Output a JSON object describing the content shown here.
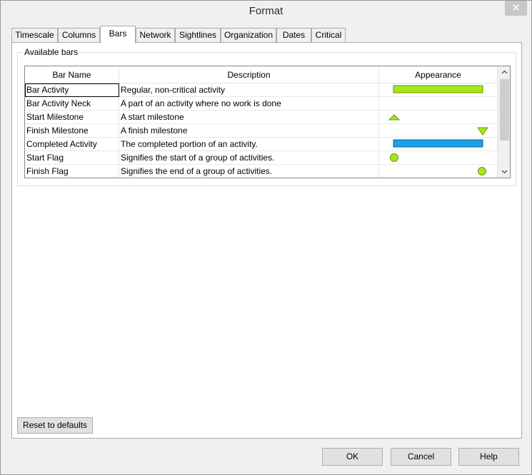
{
  "window": {
    "title": "Format",
    "close_symbol": "✕"
  },
  "tabs": [
    {
      "label": "Timescale",
      "active": false
    },
    {
      "label": "Columns",
      "active": false
    },
    {
      "label": "Bars",
      "active": true
    },
    {
      "label": "Network",
      "active": false
    },
    {
      "label": "Sightlines",
      "active": false
    },
    {
      "label": "Organization",
      "active": false
    },
    {
      "label": "Dates",
      "active": false
    },
    {
      "label": "Critical",
      "active": false
    }
  ],
  "bars_panel": {
    "group_label": "Available bars",
    "columns": [
      "Bar Name",
      "Description",
      "Appearance"
    ],
    "rows": [
      {
        "name": "Bar Activity",
        "description": "Regular, non-critical activity",
        "appearance": "green-bar",
        "selected": true
      },
      {
        "name": "Bar Activity Neck",
        "description": "A part of an activity where no work is done",
        "appearance": "none",
        "selected": false
      },
      {
        "name": "Start Milestone",
        "description": "A start milestone",
        "appearance": "green-up-triangle",
        "selected": false
      },
      {
        "name": "Finish Milestone",
        "description": "A finish milestone",
        "appearance": "green-down-triangle",
        "selected": false
      },
      {
        "name": "Completed Activity",
        "description": "The completed portion of an activity.",
        "appearance": "blue-bar",
        "selected": false
      },
      {
        "name": "Start Flag",
        "description": "Signifies the start of a group of activities.",
        "appearance": "green-circle-left",
        "selected": false
      },
      {
        "name": "Finish Flag",
        "description": "Signifies the end of a group of activities.",
        "appearance": "green-circle-right",
        "selected": false
      }
    ],
    "reset_label": "Reset to defaults"
  },
  "buttons": {
    "ok": "OK",
    "cancel": "Cancel",
    "help": "Help"
  },
  "colors": {
    "green": "#a6e61c",
    "green_border": "#6b9a10",
    "blue": "#1ca0e6",
    "blue_border": "#0b5f9a"
  }
}
